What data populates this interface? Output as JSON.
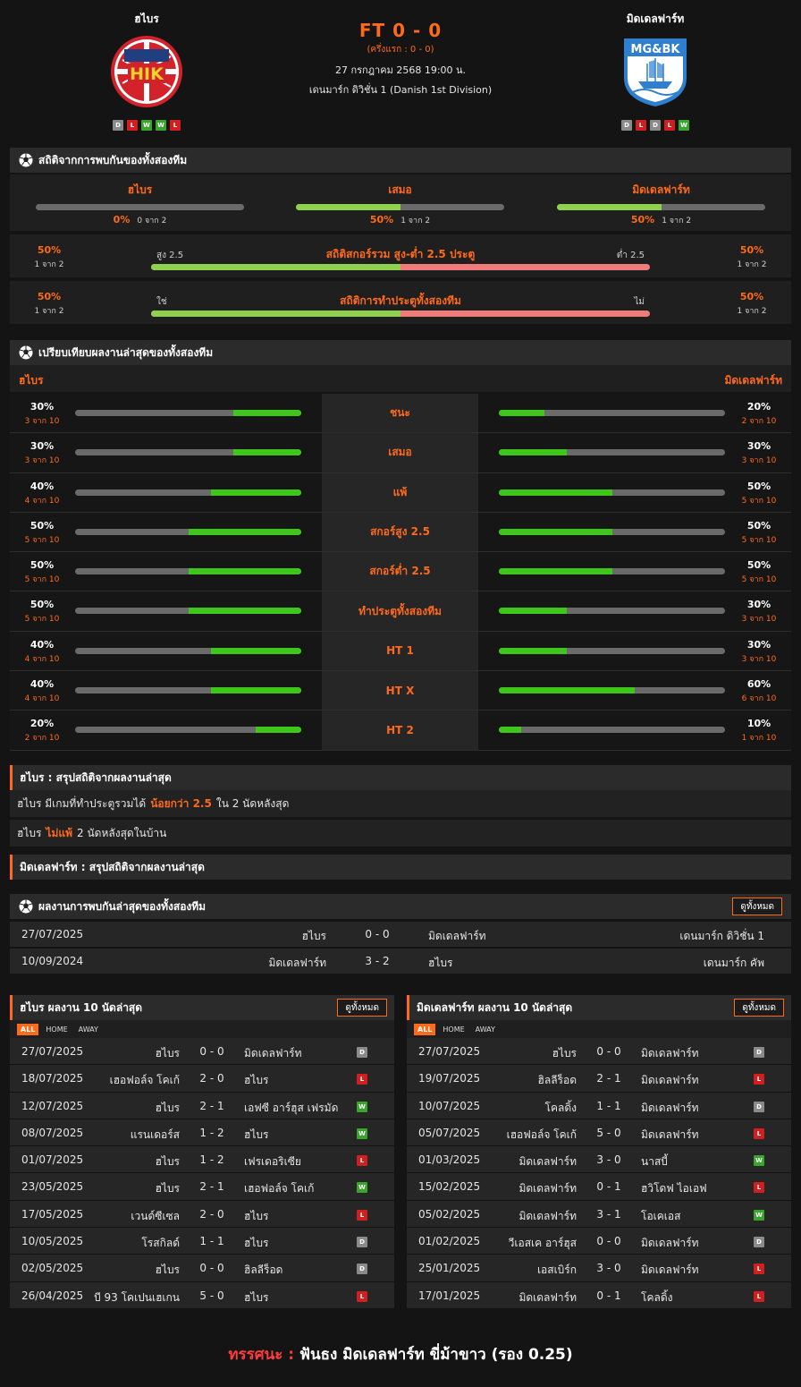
{
  "header": {
    "home_name": "ฮไบร",
    "away_name": "มิดเดลฟาร์ท",
    "score": "FT 0 - 0",
    "halftime": "(ครึ่งแรก : 0 - 0)",
    "datetime": "27 กรกฎาคม 2568 19:00 น.",
    "league": "เดนมาร์ก ดิวิชั่น 1 (Danish 1st Division)",
    "home_form": [
      "D",
      "L",
      "W",
      "W",
      "L"
    ],
    "away_form": [
      "D",
      "L",
      "D",
      "L",
      "W"
    ],
    "home_logo_text": "HIK",
    "away_logo_text": "MG&BK"
  },
  "h2h_stats": {
    "title": "สถิติจากการพบกันของทั้งสองทีม",
    "cols": [
      {
        "label": "ฮไบร",
        "pct": "0%",
        "of": "0 จาก 2",
        "value": 0
      },
      {
        "label": "เสมอ",
        "pct": "50%",
        "of": "1 จาก 2",
        "value": 0.5
      },
      {
        "label": "มิดเดลฟาร์ท",
        "pct": "50%",
        "of": "1 จาก 2",
        "value": 0.5
      }
    ],
    "ou": {
      "title": "สถิติสกอร์รวม สูง-ต่ำ 2.5 ประตู",
      "left_label": "สูง 2.5",
      "right_label": "ต่ำ 2.5",
      "left_pct": "50%",
      "left_of": "1 จาก 2",
      "right_pct": "50%",
      "right_of": "1 จาก 2",
      "value": 0.5
    },
    "btts": {
      "title": "สถิติการทำประตูทั้งสองทีม",
      "left_label": "ใช่",
      "right_label": "ไม่",
      "left_pct": "50%",
      "left_of": "1 จาก 2",
      "right_pct": "50%",
      "right_of": "1 จาก 2",
      "value": 0.5
    }
  },
  "compare": {
    "title": "เปรียบเทียบผลงานล่าสุดของทั้งสองทีม",
    "home": "ฮไบร",
    "away": "มิดเดลฟาร์ท",
    "rows": [
      {
        "label": "ชนะ",
        "hp": "30%",
        "ho": "3 จาก 10",
        "hv": 0.3,
        "ap": "20%",
        "ao": "2 จาก 10",
        "av": 0.2
      },
      {
        "label": "เสมอ",
        "hp": "30%",
        "ho": "3 จาก 10",
        "hv": 0.3,
        "ap": "30%",
        "ao": "3 จาก 10",
        "av": 0.3
      },
      {
        "label": "แพ้",
        "hp": "40%",
        "ho": "4 จาก 10",
        "hv": 0.4,
        "ap": "50%",
        "ao": "5 จาก 10",
        "av": 0.5
      },
      {
        "label": "สกอร์สูง 2.5",
        "hp": "50%",
        "ho": "5 จาก 10",
        "hv": 0.5,
        "ap": "50%",
        "ao": "5 จาก 10",
        "av": 0.5
      },
      {
        "label": "สกอร์ต่ำ 2.5",
        "hp": "50%",
        "ho": "5 จาก 10",
        "hv": 0.5,
        "ap": "50%",
        "ao": "5 จาก 10",
        "av": 0.5
      },
      {
        "label": "ทำประตูทั้งสองทีม",
        "hp": "50%",
        "ho": "5 จาก 10",
        "hv": 0.5,
        "ap": "30%",
        "ao": "3 จาก 10",
        "av": 0.3
      },
      {
        "label": "HT 1",
        "hp": "40%",
        "ho": "4 จาก 10",
        "hv": 0.4,
        "ap": "30%",
        "ao": "3 จาก 10",
        "av": 0.3
      },
      {
        "label": "HT X",
        "hp": "40%",
        "ho": "4 จาก 10",
        "hv": 0.4,
        "ap": "60%",
        "ao": "6 จาก 10",
        "av": 0.6
      },
      {
        "label": "HT 2",
        "hp": "20%",
        "ho": "2 จาก 10",
        "hv": 0.2,
        "ap": "10%",
        "ao": "1 จาก 10",
        "av": 0.1
      }
    ]
  },
  "home_summary": {
    "title": "ฮไบร : สรุปสถิติจากผลงานล่าสุด",
    "line1_a": "ฮไบร  มีเกมที่ทำประตูรวมได้",
    "line1_hl": "น้อยกว่า  2.5",
    "line1_b": "ใน 2 นัดหลังสุด",
    "line2_a": "ฮไบร",
    "line2_hl": "ไม่แพ้",
    "line2_b": "2  นัดหลังสุดในบ้าน"
  },
  "away_summary": {
    "title": "มิดเดลฟาร์ท : สรุปสถิติจากผลงานล่าสุด"
  },
  "h2h_recent": {
    "title": "ผลงานการพบกันล่าสุดของทั้งสองทีม",
    "view_all": "ดูทั้งหมด",
    "rows": [
      {
        "date": "27/07/2025",
        "home": "ฮไบร",
        "score": "0 - 0",
        "away": "มิดเดลฟาร์ท",
        "league": "เดนมาร์ก ดิวิชั่น 1"
      },
      {
        "date": "10/09/2024",
        "home": "มิดเดลฟาร์ท",
        "score": "3 - 2",
        "away": "ฮไบร",
        "league": "เดนมาร์ก คัพ"
      }
    ]
  },
  "last10_home": {
    "title": "ฮไบร ผลงาน 10 นัดล่าสุด",
    "view_all": "ดูทั้งหมด",
    "tabs": [
      "ALL",
      "HOME",
      "AWAY"
    ],
    "rows": [
      {
        "date": "27/07/2025",
        "home": "ฮไบร",
        "score": "0 - 0",
        "away": "มิดเดลฟาร์ท",
        "res": "D"
      },
      {
        "date": "18/07/2025",
        "home": "เฮอฟอล์จ โคเก้",
        "score": "2 - 0",
        "away": "ฮไบร",
        "res": "L"
      },
      {
        "date": "12/07/2025",
        "home": "ฮไบร",
        "score": "2 - 1",
        "away": "เอฟซี อาร์ฮุส เฟรมัด",
        "res": "W"
      },
      {
        "date": "08/07/2025",
        "home": "แรนเดอร์ส",
        "score": "1 - 2",
        "away": "ฮไบร",
        "res": "W"
      },
      {
        "date": "01/07/2025",
        "home": "ฮไบร",
        "score": "1 - 2",
        "away": "เฟรเดอริเซีย",
        "res": "L"
      },
      {
        "date": "23/05/2025",
        "home": "ฮไบร",
        "score": "2 - 1",
        "away": "เฮอฟอล์จ โคเก้",
        "res": "W"
      },
      {
        "date": "17/05/2025",
        "home": "เวนด์ซีเซล",
        "score": "2 - 0",
        "away": "ฮไบร",
        "res": "L"
      },
      {
        "date": "10/05/2025",
        "home": "โรสกิลด์",
        "score": "1 - 1",
        "away": "ฮไบร",
        "res": "D"
      },
      {
        "date": "02/05/2025",
        "home": "ฮไบร",
        "score": "0 - 0",
        "away": "ฮิลลีร็อด",
        "res": "D"
      },
      {
        "date": "26/04/2025",
        "home": "บี 93 โคเปนเฮเกน",
        "score": "5 - 0",
        "away": "ฮไบร",
        "res": "L"
      }
    ]
  },
  "last10_away": {
    "title": "มิดเดลฟาร์ท ผลงาน 10 นัดล่าสุด",
    "view_all": "ดูทั้งหมด",
    "tabs": [
      "ALL",
      "HOME",
      "AWAY"
    ],
    "rows": [
      {
        "date": "27/07/2025",
        "home": "ฮไบร",
        "score": "0 - 0",
        "away": "มิดเดลฟาร์ท",
        "res": "D"
      },
      {
        "date": "19/07/2025",
        "home": "ฮิลลีร็อด",
        "score": "2 - 1",
        "away": "มิดเดลฟาร์ท",
        "res": "L"
      },
      {
        "date": "10/07/2025",
        "home": "โคลดิ้ง",
        "score": "1 - 1",
        "away": "มิดเดลฟาร์ท",
        "res": "D"
      },
      {
        "date": "05/07/2025",
        "home": "เฮอฟอล์จ โคเก้",
        "score": "5 - 0",
        "away": "มิดเดลฟาร์ท",
        "res": "L"
      },
      {
        "date": "01/03/2025",
        "home": "มิดเดลฟาร์ท",
        "score": "3 - 0",
        "away": "นาสบี้",
        "res": "W"
      },
      {
        "date": "15/02/2025",
        "home": "มิดเดลฟาร์ท",
        "score": "0 - 1",
        "away": "ฮวิโดฟ ไอเอฟ",
        "res": "L"
      },
      {
        "date": "05/02/2025",
        "home": "มิดเดลฟาร์ท",
        "score": "3 - 1",
        "away": "โอเคเอส",
        "res": "W"
      },
      {
        "date": "01/02/2025",
        "home": "วีเอสเค อาร์ฮุส",
        "score": "0 - 0",
        "away": "มิดเดลฟาร์ท",
        "res": "D"
      },
      {
        "date": "25/01/2025",
        "home": "เอสเบิร์ก",
        "score": "3 - 0",
        "away": "มิดเดลฟาร์ท",
        "res": "L"
      },
      {
        "date": "17/01/2025",
        "home": "มิดเดลฟาร์ท",
        "score": "0 - 1",
        "away": "โคลดิ้ง",
        "res": "L"
      }
    ]
  },
  "verdict": {
    "label": "ทรรศนะ :",
    "text": "ฟันธง มิดเดลฟาร์ท ขี่ม้าขาว (รอง 0.25)"
  },
  "colors": {
    "accent": "#ff6a1a",
    "green": "#8fd14f",
    "bright_green": "#3ec71a",
    "red_bar": "#f07b7b",
    "win": "#3aa52b",
    "loss": "#d11f1f",
    "draw": "#8a8a8a"
  }
}
